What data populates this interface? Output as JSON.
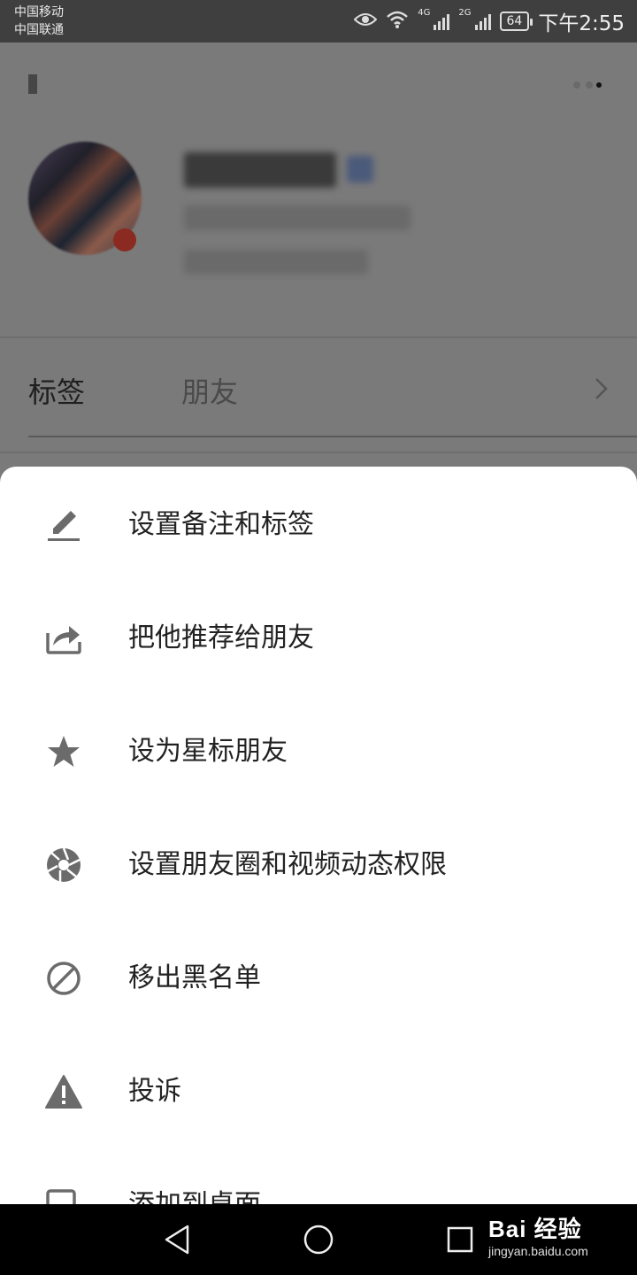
{
  "status_bar": {
    "carrier1": "中国移动",
    "carrier2": "中国联通",
    "net1": "4G",
    "net2": "2G",
    "battery": "64",
    "time": "下午2:55"
  },
  "profile": {
    "tag_label": "标签",
    "tag_value": "朋友"
  },
  "menu": {
    "items": [
      {
        "label": "设置备注和标签",
        "icon": "edit-icon"
      },
      {
        "label": "把他推荐给朋友",
        "icon": "share-icon"
      },
      {
        "label": "设为星标朋友",
        "icon": "star-icon"
      },
      {
        "label": "设置朋友圈和视频动态权限",
        "icon": "aperture-icon"
      },
      {
        "label": "移出黑名单",
        "icon": "block-icon"
      },
      {
        "label": "投诉",
        "icon": "warning-icon"
      },
      {
        "label": "添加到桌面",
        "icon": "add-to-desktop-icon"
      }
    ]
  },
  "watermark": {
    "main": "Bai 经验",
    "sub": "jingyan.baidu.com"
  },
  "colors": {
    "overlay": "#7a7a7a",
    "sheet": "#ffffff",
    "icon": "#6b6b6b",
    "text": "#222222"
  }
}
